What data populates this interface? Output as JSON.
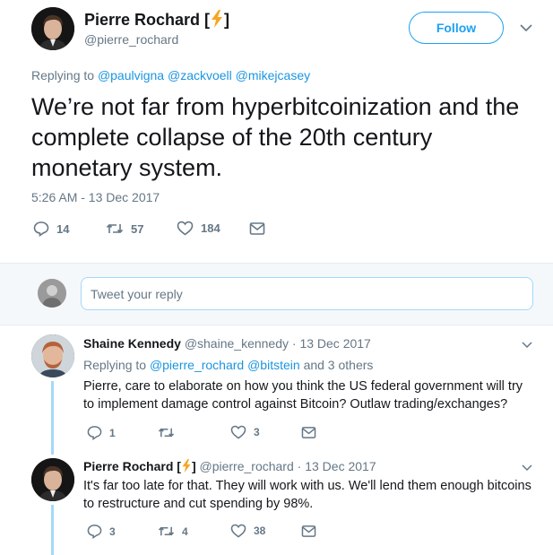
{
  "main_tweet": {
    "author_name": "Pierre Rochard [",
    "author_name_end": "]",
    "lightning_icon": "lightning-icon",
    "handle": "@pierre_rochard",
    "follow_label": "Follow",
    "replying_label": "Replying to",
    "replying_to": "@paulvigna @zackvoell @mikejcasey",
    "text": "We’re not far from hyperbitcoinization and the complete collapse of the 20th century monetary system.",
    "timestamp": "5:26 AM - 13 Dec 2017",
    "replies": "14",
    "retweets": "57",
    "likes": "184"
  },
  "reply_box": {
    "placeholder": "Tweet your reply"
  },
  "replies": [
    {
      "author_name": "Shaine Kennedy",
      "handle": "@shaine_kennedy",
      "date": "· 13 Dec 2017",
      "replying_label": "Replying to",
      "replying_to": "@pierre_rochard @bitstein",
      "replying_more": "and 3 others",
      "text": "Pierre, care to elaborate on how you think the US federal government will try to implement damage control against Bitcoin? Outlaw trading/exchanges?",
      "replies": "1",
      "retweets": "",
      "likes": "3"
    },
    {
      "author_name": "Pierre Rochard [",
      "author_name_end": "]",
      "handle": "@pierre_rochard",
      "date": "· 13 Dec 2017",
      "text": "It's far too late for that. They will work with us. We'll lend them enough bitcoins to restructure and cut spending by 98%.",
      "replies": "3",
      "retweets": "4",
      "likes": "38"
    }
  ],
  "colors": {
    "accent": "#1da1f2",
    "link": "#1b95e0",
    "muted": "#657786",
    "lightning": "#f5a623",
    "thread_line": "#a4d9f9"
  }
}
